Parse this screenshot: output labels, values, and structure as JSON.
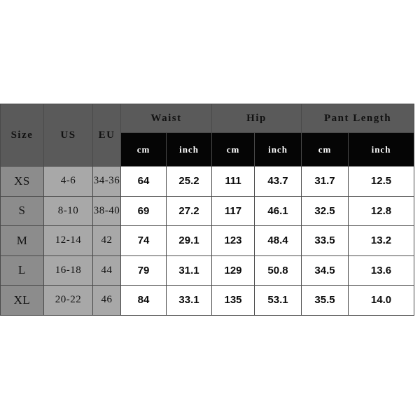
{
  "table": {
    "header": {
      "size_label": "Size",
      "us_label": "US",
      "eu_label": "EU",
      "groups": [
        {
          "label": "Waist",
          "units": [
            "cm",
            "inch"
          ]
        },
        {
          "label": "Hip",
          "units": [
            "cm",
            "inch"
          ]
        },
        {
          "label": "Pant Length",
          "units": [
            "cm",
            "inch"
          ]
        }
      ]
    },
    "rows": [
      {
        "size": "XS",
        "us": "4-6",
        "eu": "34-36",
        "waist_cm": "64",
        "waist_inch": "25.2",
        "hip_cm": "111",
        "hip_inch": "43.7",
        "pant_cm": "31.7",
        "pant_inch": "12.5"
      },
      {
        "size": "S",
        "us": "8-10",
        "eu": "38-40",
        "waist_cm": "69",
        "waist_inch": "27.2",
        "hip_cm": "117",
        "hip_inch": "46.1",
        "pant_cm": "32.5",
        "pant_inch": "12.8"
      },
      {
        "size": "M",
        "us": "12-14",
        "eu": "42",
        "waist_cm": "74",
        "waist_inch": "29.1",
        "hip_cm": "123",
        "hip_inch": "48.4",
        "pant_cm": "33.5",
        "pant_inch": "13.2"
      },
      {
        "size": "L",
        "us": "16-18",
        "eu": "44",
        "waist_cm": "79",
        "waist_inch": "31.1",
        "hip_cm": "129",
        "hip_inch": "50.8",
        "pant_cm": "34.5",
        "pant_inch": "13.6"
      },
      {
        "size": "XL",
        "us": "20-22",
        "eu": "46",
        "waist_cm": "84",
        "waist_inch": "33.1",
        "hip_cm": "135",
        "hip_inch": "53.1",
        "pant_cm": "35.5",
        "pant_inch": "14.0"
      }
    ]
  },
  "colors": {
    "header_gray": "#5a5a5a",
    "subheader_black": "#050505",
    "size_column": "#8c8c8c",
    "useu_column": "#a8a8a8",
    "data_background": "#ffffff",
    "page_background": "#ffffff"
  }
}
